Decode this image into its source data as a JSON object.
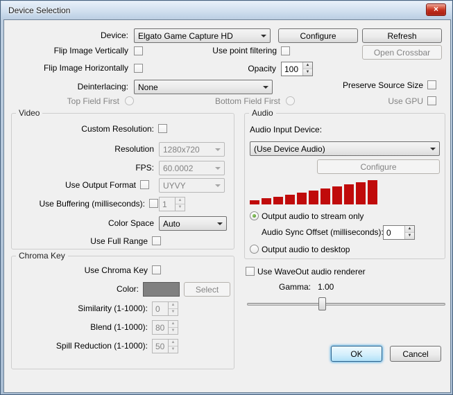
{
  "window": {
    "title": "Device Selection",
    "close_glyph": "×"
  },
  "header": {
    "device_label": "Device:",
    "device_value": "Elgato Game Capture HD",
    "configure": "Configure",
    "refresh": "Refresh",
    "flip_vertical": "Flip Image Vertically",
    "point_filtering": "Use point filtering",
    "open_crossbar": "Open Crossbar",
    "flip_horizontal": "Flip Image Horizontally",
    "opacity_label": "Opacity",
    "opacity_value": "100",
    "deinterlacing_label": "Deinterlacing:",
    "deinterlacing_value": "None",
    "preserve_source_size": "Preserve Source Size",
    "top_field_first": "Top Field First",
    "bottom_field_first": "Bottom Field First",
    "use_gpu": "Use GPU"
  },
  "video": {
    "title": "Video",
    "custom_resolution_label": "Custom Resolution:",
    "resolution_label": "Resolution",
    "resolution_value": "1280x720",
    "fps_label": "FPS:",
    "fps_value": "60.0002",
    "output_format_label": "Use Output Format",
    "output_format_value": "UYVY",
    "buffering_label": "Use Buffering (milliseconds):",
    "buffering_value": "1",
    "color_space_label": "Color Space",
    "color_space_value": "Auto",
    "full_range_label": "Use Full Range"
  },
  "chroma": {
    "title": "Chroma Key",
    "use_chroma_label": "Use Chroma Key",
    "color_label": "Color:",
    "select_label": "Select",
    "similarity_label": "Similarity (1-1000):",
    "similarity_value": "0",
    "blend_label": "Blend (1-1000):",
    "blend_value": "80",
    "spill_label": "Spill Reduction (1-1000):",
    "spill_value": "50"
  },
  "audio": {
    "title": "Audio",
    "input_device_label": "Audio Input Device:",
    "input_device_value": "(Use Device Audio)",
    "configure": "Configure",
    "meter_bars": [
      6,
      9,
      11,
      14,
      17,
      20,
      23,
      26,
      29,
      32,
      35
    ],
    "stream_only_label": "Output audio to stream only",
    "sync_offset_label": "Audio Sync Offset (milliseconds):",
    "sync_offset_value": "0",
    "desktop_label": "Output audio to desktop"
  },
  "footer": {
    "waveout_label": "Use WaveOut audio renderer",
    "gamma_label": "Gamma:",
    "gamma_value": "1.00",
    "ok": "OK",
    "cancel": "Cancel"
  },
  "colors": {
    "meter_red": "#c00b0b",
    "chroma_swatch": "#808080"
  }
}
